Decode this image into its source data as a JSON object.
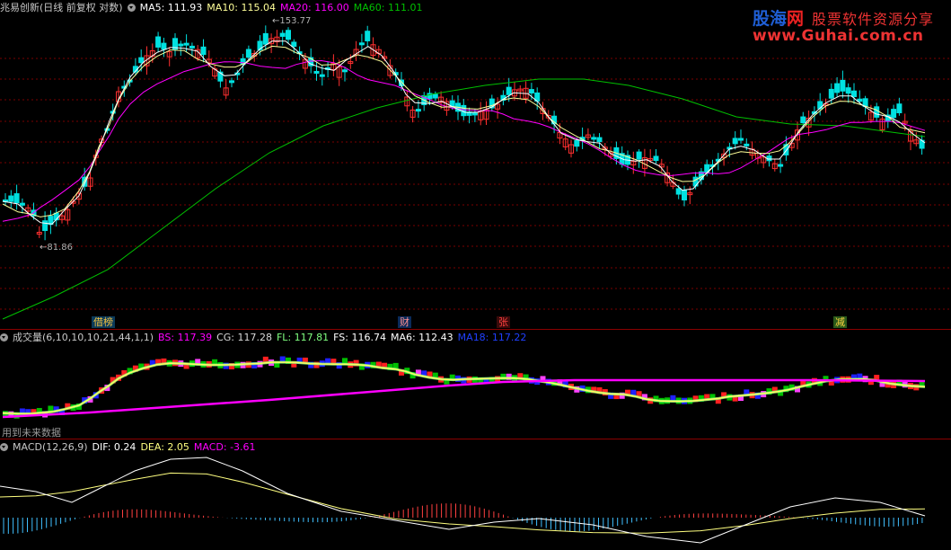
{
  "colors": {
    "bg": "#000000",
    "up": "#ff3030",
    "down": "#00e0e0",
    "ma5": "#ffffff",
    "ma10": "#ffff99",
    "ma20": "#ff00ff",
    "ma60": "#00c000",
    "grid": "#8b0000"
  },
  "main": {
    "stock_name": "兆易创新(日线 前复权 对数)",
    "menu_icon": "dropdown-circle-icon",
    "ma5": "MA5: 111.93",
    "ma10": "MA10: 115.04",
    "ma20": "MA20: 116.00",
    "ma60": "MA60: 111.01",
    "high_label": "153.77",
    "low_label": "81.86",
    "markers": [
      {
        "text": "借榜",
        "color": "#f0c040"
      },
      {
        "text": "财",
        "color": "#ff8080"
      },
      {
        "text": "张",
        "color": "#ff4040"
      },
      {
        "text": "减",
        "color": "#ffd040"
      }
    ]
  },
  "watermark": {
    "logo_a": "股海",
    "logo_b": "网",
    "slogan": "股票软件资源分享",
    "url": "www.Guhai.com.cn"
  },
  "volume": {
    "title": "成交量(6,10,10,10,21,44,1,1)",
    "bs": "BS: 117.39",
    "cg": "CG: 117.28",
    "fl": "FL: 117.81",
    "fs": "FS: 116.74",
    "ma6": "MA6: 112.43",
    "ma18": "MA18: 117.22",
    "note": "用到未来数据"
  },
  "macd": {
    "title": "MACD(12,26,9)",
    "dif": "DIF: 0.24",
    "dea": "DEA: 2.05",
    "macd": "MACD: -3.61"
  }
}
